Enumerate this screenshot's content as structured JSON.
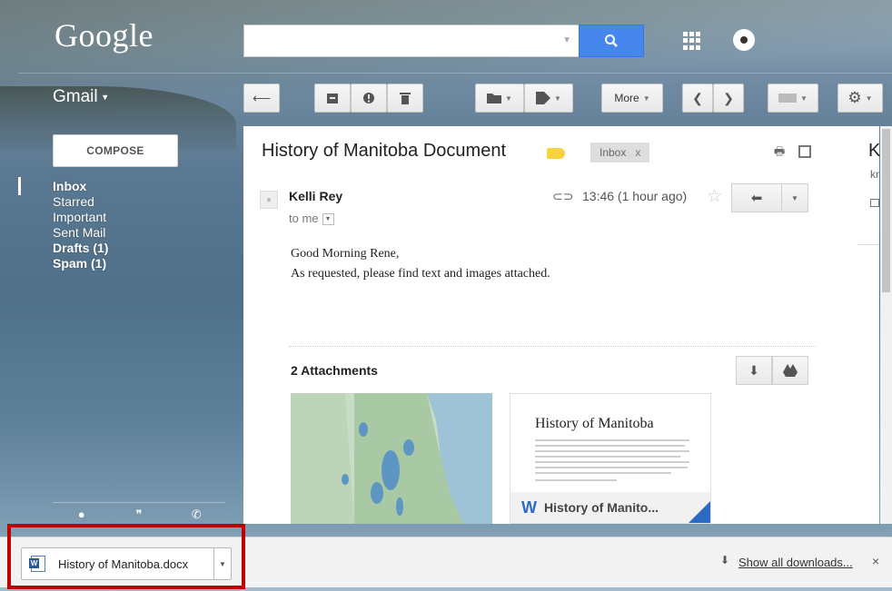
{
  "header": {
    "logo": "Google",
    "search_placeholder": "",
    "app_label": "Gmail"
  },
  "toolbar": {
    "more_label": "More"
  },
  "sidebar": {
    "compose_label": "COMPOSE",
    "items": [
      {
        "label": "Inbox",
        "bold": true
      },
      {
        "label": "Starred",
        "bold": false
      },
      {
        "label": "Important",
        "bold": false
      },
      {
        "label": "Sent Mail",
        "bold": false
      },
      {
        "label": "Drafts (1)",
        "bold": true
      },
      {
        "label": "Spam (1)",
        "bold": true
      }
    ]
  },
  "message": {
    "subject": "History of Manitoba Document",
    "label_chip": "Inbox",
    "label_chip_close": "x",
    "sender": "Kelli Rey",
    "to": "to me",
    "timestamp": "13:46 (1 hour ago)",
    "body_lines": [
      "Good Morning Rene,",
      "As requested, please find text and images attached."
    ],
    "attachments_title": "2 Attachments",
    "attachments": [
      {
        "type": "map-image"
      },
      {
        "type": "word-doc",
        "preview_title": "History of Manitoba",
        "name": "History of Manito..."
      }
    ]
  },
  "side_panel": {
    "initial": "K",
    "short": "kr"
  },
  "download_bar": {
    "file_name": "History of Manitoba.docx",
    "show_all": "Show all downloads...",
    "close": "×"
  },
  "colors": {
    "accent_blue": "#4787ed",
    "label_yellow": "#f7d33c",
    "highlight_red": "#c00000",
    "word_blue": "#2b6bc4"
  }
}
